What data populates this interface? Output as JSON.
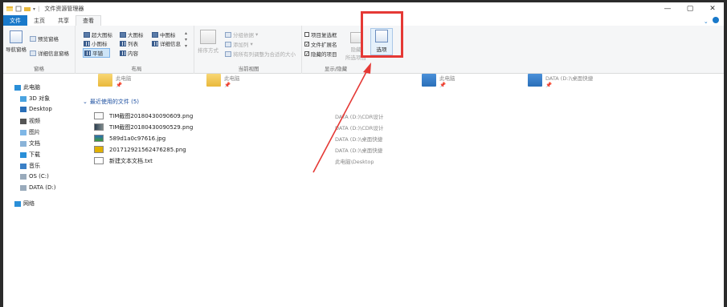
{
  "window": {
    "title": "文件资源管理器",
    "controls": {
      "minimize": "—",
      "maximize": "▢",
      "close": "✕"
    }
  },
  "tabs": [
    {
      "label": "文件"
    },
    {
      "label": "主页"
    },
    {
      "label": "共享"
    },
    {
      "label": "查看"
    }
  ],
  "ribbon": {
    "panes": {
      "label": "窗格",
      "nav_pane": "导航窗格",
      "preview_pane": "预览窗格",
      "details_pane": "详细信息窗格"
    },
    "layout": {
      "label": "布局",
      "items": [
        "超大图标",
        "大图标",
        "中图标",
        "小图标",
        "列表",
        "详细信息",
        "平铺",
        "内容"
      ]
    },
    "current_view": {
      "label": "当前视图",
      "sort_by": "排序方式",
      "group_by": "分组依据",
      "add_columns": "添加列",
      "fit_columns": "将所有列调整为合适的大小"
    },
    "show_hide": {
      "label": "显示/隐藏",
      "item_checkboxes": "项目复选框",
      "file_extensions": "文件扩展名",
      "hidden_items": "隐藏的项目",
      "hide_selected": "隐藏",
      "hide_selected_2": "所选项目",
      "checkbox_states": {
        "item_checkboxes": false,
        "file_extensions": true,
        "hidden_items": true
      }
    },
    "options": {
      "label": "选项"
    }
  },
  "nav_pane": {
    "items": [
      {
        "label": "此电脑",
        "icon": "computer-icon"
      },
      {
        "label": "3D 对象",
        "icon": "3d-objects-icon"
      },
      {
        "label": "Desktop",
        "icon": "desktop-icon"
      },
      {
        "label": "视频",
        "icon": "video-icon"
      },
      {
        "label": "图片",
        "icon": "pictures-icon"
      },
      {
        "label": "文档",
        "icon": "documents-icon"
      },
      {
        "label": "下载",
        "icon": "downloads-icon"
      },
      {
        "label": "音乐",
        "icon": "music-icon"
      },
      {
        "label": "OS (C:)",
        "icon": "drive-icon"
      },
      {
        "label": "DATA (D:)",
        "icon": "drive-icon"
      },
      {
        "label": "网络",
        "icon": "network-icon"
      }
    ]
  },
  "quick_access": [
    {
      "label": "此电脑"
    },
    {
      "label": "此电脑"
    },
    {
      "label": "此电脑"
    },
    {
      "label": "DATA (D:)\\桌面快捷"
    }
  ],
  "recent": {
    "header": "最近使用的文件 (5)",
    "files": [
      {
        "name": "TIM截图20180430090609.png",
        "path": "DATA (D:)\\CDR设计"
      },
      {
        "name": "TIM截图20180430090529.png",
        "path": "DATA (D:)\\CDR设计"
      },
      {
        "name": "589d1a0c97616.jpg",
        "path": "DATA (D:)\\桌面快捷"
      },
      {
        "name": "20171292156247628​5.png",
        "path": "DATA (D:)\\桌面快捷"
      },
      {
        "name": "新建文本文档.txt",
        "path": "此电脑\\Desktop"
      }
    ]
  },
  "colors": {
    "accent": "#1979ca",
    "highlight": "#e53935"
  }
}
